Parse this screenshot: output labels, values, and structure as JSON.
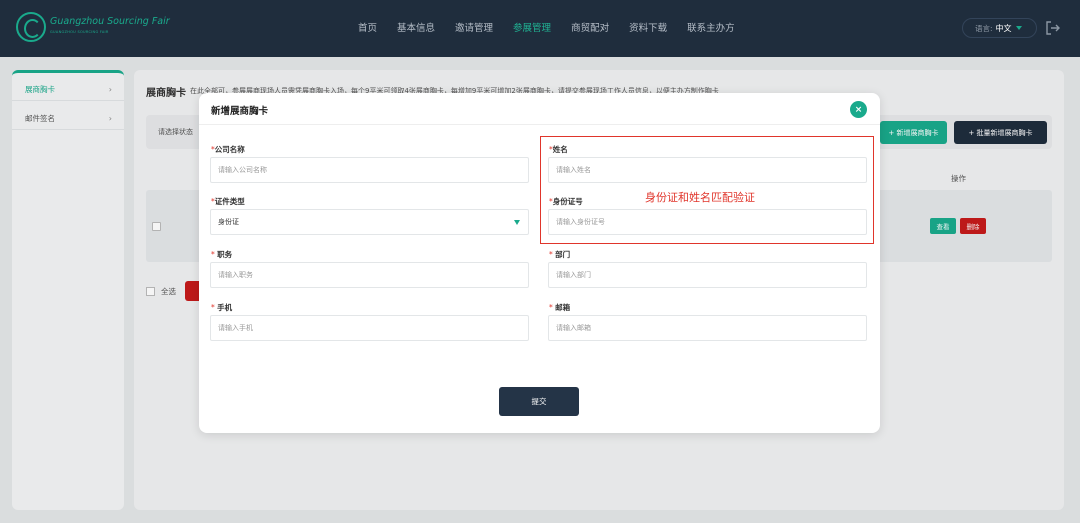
{
  "header": {
    "brand": "Guangzhou Sourcing Fair",
    "brand_sub": "GUANGZHOU SOURCING FAIR",
    "nav": [
      "首页",
      "基本信息",
      "邀请管理",
      "参展管理",
      "商贸配对",
      "资料下载",
      "联系主办方"
    ],
    "active_nav": "参展管理",
    "lang_label": "语言:",
    "lang_value": "中文"
  },
  "sidebar": {
    "items": [
      {
        "label": "展商胸卡",
        "active": true
      },
      {
        "label": "邮件签名",
        "active": false
      }
    ]
  },
  "main": {
    "title": "展商胸卡",
    "desc": "在此全部可，参展展商现场人员需凭展商胸卡入场，每个9平米可领取4张展商胸卡，每增加9平米可增加2张展商胸卡，请提交参展现场工作人员信息，以便主办方制作胸卡",
    "filter_placeholder": "请选择状态",
    "add_button": "+ 新增展商胸卡",
    "batch_button": "+ 批量新增展商胸卡",
    "col_operation": "操作",
    "view_button": "查看",
    "delete_button": "删除",
    "select_all": "全选"
  },
  "modal": {
    "title": "新增展商胸卡",
    "close": "×",
    "fields": {
      "company": {
        "label": "公司名称",
        "placeholder": "请输入公司名称"
      },
      "name": {
        "label": "姓名",
        "placeholder": "请输入姓名"
      },
      "id_type": {
        "label": "证件类型",
        "value": "身份证"
      },
      "id_number": {
        "label": "身份证号",
        "placeholder": "请输入身份证号"
      },
      "position": {
        "label": "职务",
        "placeholder": "请输入职务"
      },
      "department": {
        "label": "部门",
        "placeholder": "请输入部门"
      },
      "phone": {
        "label": "手机",
        "placeholder": "请输入手机"
      },
      "email": {
        "label": "邮箱",
        "placeholder": "请输入邮箱"
      }
    },
    "submit": "提交",
    "annotation": "身份证和姓名匹配验证"
  },
  "colors": {
    "accent": "#1aaa8c",
    "header": "#1f2d3d",
    "danger": "#c51b1b",
    "annotation": "#e0352b"
  }
}
